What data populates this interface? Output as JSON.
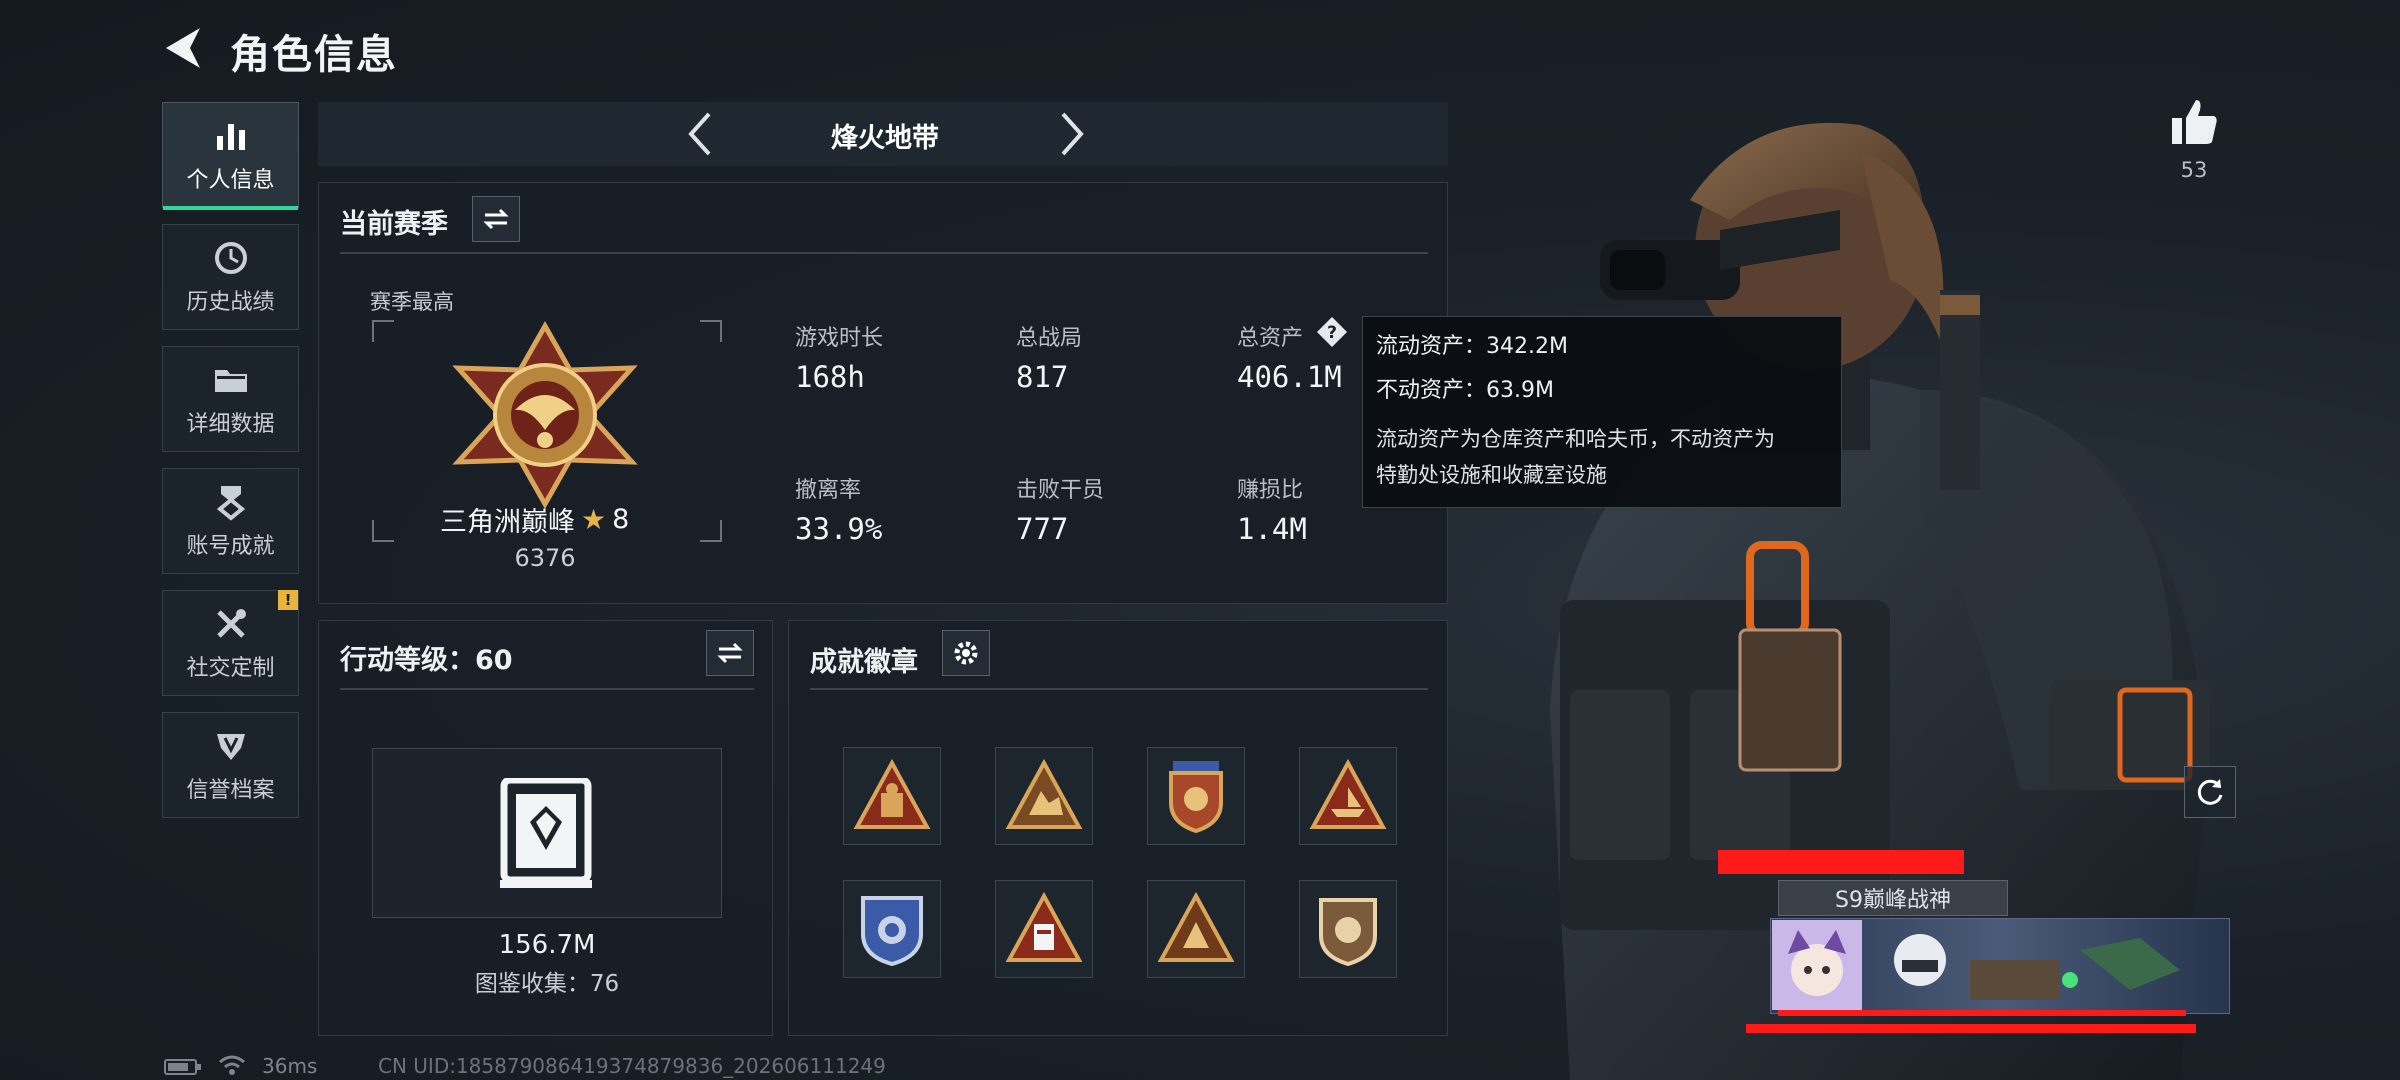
{
  "header": {
    "title": "角色信息"
  },
  "sidebar": {
    "items": [
      {
        "label": "个人信息"
      },
      {
        "label": "历史战绩"
      },
      {
        "label": "详细数据"
      },
      {
        "label": "账号成就"
      },
      {
        "label": "社交定制"
      },
      {
        "label": "信誉档案"
      }
    ],
    "notification_badge": "!"
  },
  "mode": {
    "title": "烽火地带"
  },
  "season": {
    "title": "当前赛季",
    "best_label": "赛季最高",
    "rank_name": "三角洲巅峰",
    "rank_star": "★",
    "rank_stars": "8",
    "rank_score": "6376",
    "stats": [
      {
        "label": "游戏时长",
        "value": "168h"
      },
      {
        "label": "总战局",
        "value": "817"
      },
      {
        "label": "总资产",
        "value": "406.1M"
      },
      {
        "label": "撤离率",
        "value": "33.9%"
      },
      {
        "label": "击败干员",
        "value": "777"
      },
      {
        "label": "赚损比",
        "value": "1.4M"
      }
    ]
  },
  "tooltip": {
    "liquid": "流动资产：342.2M",
    "fixed": "不动资产：63.9M",
    "note_line1": "流动资产为仓库资产和哈夫币，不动资产为",
    "note_line2": "特勤处设施和收藏室设施"
  },
  "action_level": {
    "title": "行动等级：60",
    "value": "156.7M",
    "collection": "图鉴收集：76"
  },
  "achievements": {
    "title": "成就徽章",
    "badges": [
      "badge-1-icon",
      "badge-2-icon",
      "badge-3-icon",
      "badge-4-icon",
      "badge-5-icon",
      "badge-6-icon",
      "badge-7-icon",
      "badge-8-icon"
    ]
  },
  "likes": {
    "count": "53"
  },
  "card": {
    "title": "S9巅峰战神"
  },
  "status": {
    "ping": "36ms",
    "uid": "CN UID:18587908641937487983​6_20260611​1249"
  },
  "colors": {
    "accent": "#2fd99a",
    "badge": "#e8b43a",
    "redaction": "#ff1a1a"
  }
}
